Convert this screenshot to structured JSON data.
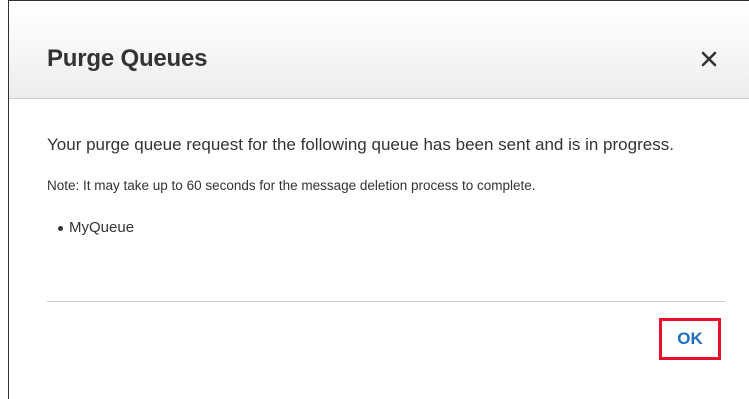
{
  "dialog": {
    "title": "Purge Queues",
    "close_icon": "close-icon",
    "message": "Your purge queue request for the following queue has been sent and is in progress.",
    "note": "Note: It may take up to 60 seconds for the message deletion process to complete.",
    "queues": [
      "MyQueue"
    ],
    "ok_label": "OK"
  },
  "colors": {
    "ok_text": "#1f6fbf",
    "highlight_border": "#e8112d",
    "text": "#333333"
  }
}
